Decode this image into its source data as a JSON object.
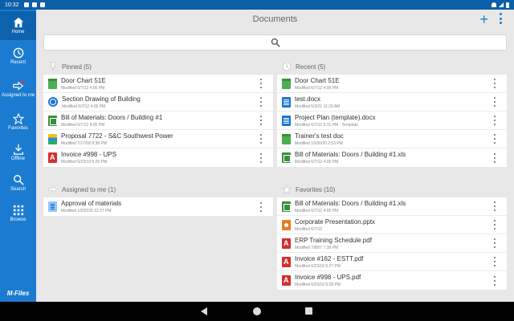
{
  "status": {
    "time": "10:32"
  },
  "sidebar": {
    "items": [
      {
        "label": "Home",
        "icon": "home-icon"
      },
      {
        "label": "Recent",
        "icon": "clock-icon"
      },
      {
        "label": "Assigned to me",
        "icon": "assigned-arrow-icon"
      },
      {
        "label": "Favorites",
        "icon": "star-icon"
      },
      {
        "label": "Offline",
        "icon": "download-icon"
      },
      {
        "label": "Search",
        "icon": "search-icon"
      },
      {
        "label": "Browse",
        "icon": "grid-icon"
      }
    ],
    "brand": "M-Files"
  },
  "header": {
    "title": "Documents",
    "add_label": "+"
  },
  "panels": {
    "pinned": {
      "title": "Pinned (5)",
      "items": [
        {
          "title": "Door Chart 51E",
          "meta": "Modified 6/7/12 4:06 PM",
          "icon": "generic"
        },
        {
          "title": "Section Drawing of Building",
          "meta": "Modified 6/7/12 4:06 PM",
          "icon": "globe"
        },
        {
          "title": "Bill of Materials: Doors / Building #1",
          "meta": "Modified 6/7/12 4:05 PM",
          "icon": "xls"
        },
        {
          "title": "Proposal 7722 - S&C Southwest Power",
          "meta": "Modified 7/17/08 8:38 PM",
          "icon": "stack"
        },
        {
          "title": "Invoice #998 - UPS",
          "meta": "Modified 6/23/10 5:29 PM",
          "icon": "pdf"
        }
      ]
    },
    "recent": {
      "title": "Recent (5)",
      "items": [
        {
          "title": "Door Chart 51E",
          "meta": "Modified 6/7/12 4:06 PM",
          "icon": "generic"
        },
        {
          "title": "test.docx",
          "meta": "Modified 5/3/21 11:33 AM",
          "icon": "doc"
        },
        {
          "title": "Project Plan (template).docx",
          "meta": "Modified 6/7/12 5:31 PM · Template",
          "icon": "doc"
        },
        {
          "title": "Trainer's test doc",
          "meta": "Modified 10/30/20 2:53 PM",
          "icon": "generic"
        },
        {
          "title": "Bill of Materials: Doors / Building #1.xls",
          "meta": "Modified 6/7/12 4:05 PM",
          "icon": "xls"
        }
      ]
    },
    "assigned": {
      "title": "Assigned to me (1)",
      "items": [
        {
          "title": "Approval of materials",
          "meta": "Modified 10/20/20 12:27 PM",
          "icon": "clip"
        }
      ]
    },
    "favorites": {
      "title": "Favorites (10)",
      "items": [
        {
          "title": "Bill of Materials: Doors / Building #1.xls",
          "meta": "Modified 6/7/12 4:05 PM",
          "icon": "xls"
        },
        {
          "title": "Corporate Presentation.pptx",
          "meta": "Modified 6/7/12",
          "icon": "ppt"
        },
        {
          "title": "ERP Training Schedule.pdf",
          "meta": "Modified 7/8/07 7:38 PM",
          "icon": "pdf"
        },
        {
          "title": "Invoice #162 - ESTT.pdf",
          "meta": "Modified 6/23/10 5:27 PM",
          "icon": "pdf"
        },
        {
          "title": "Invoice #998 - UPS.pdf",
          "meta": "Modified 6/23/10 5:28 PM",
          "icon": "pdf"
        }
      ]
    }
  }
}
